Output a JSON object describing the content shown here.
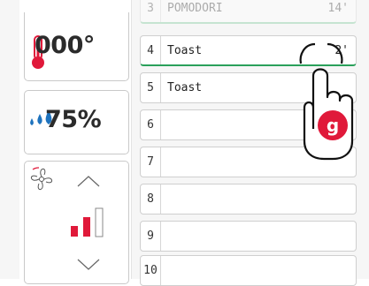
{
  "temperature": {
    "value": "000°"
  },
  "humidity": {
    "value": "75%"
  },
  "fan": {
    "level_filled": 2,
    "level_total": 3
  },
  "programs": [
    {
      "num": "3",
      "name": "POMODORI",
      "time": "14'"
    },
    {
      "num": "4",
      "name": "Toast",
      "time": "2'"
    },
    {
      "num": "5",
      "name": "Toast",
      "time": ""
    },
    {
      "num": "6",
      "name": "",
      "time": ""
    },
    {
      "num": "7",
      "name": "",
      "time": ""
    },
    {
      "num": "8",
      "name": "",
      "time": ""
    },
    {
      "num": "9",
      "name": "",
      "time": ""
    },
    {
      "num": "10",
      "name": "",
      "time": ""
    }
  ],
  "gesture": {
    "label": "g"
  },
  "colors": {
    "accent_red": "#e0193a",
    "humidity_blue": "#1e73be",
    "active_green": "#2aa05a"
  },
  "icons": {
    "temperature": "thermometer-icon",
    "humidity": "water-drops-icon",
    "fan": "fan-icon",
    "up": "chevron-up-icon",
    "down": "chevron-down-icon",
    "gesture": "tap-hand-icon"
  }
}
